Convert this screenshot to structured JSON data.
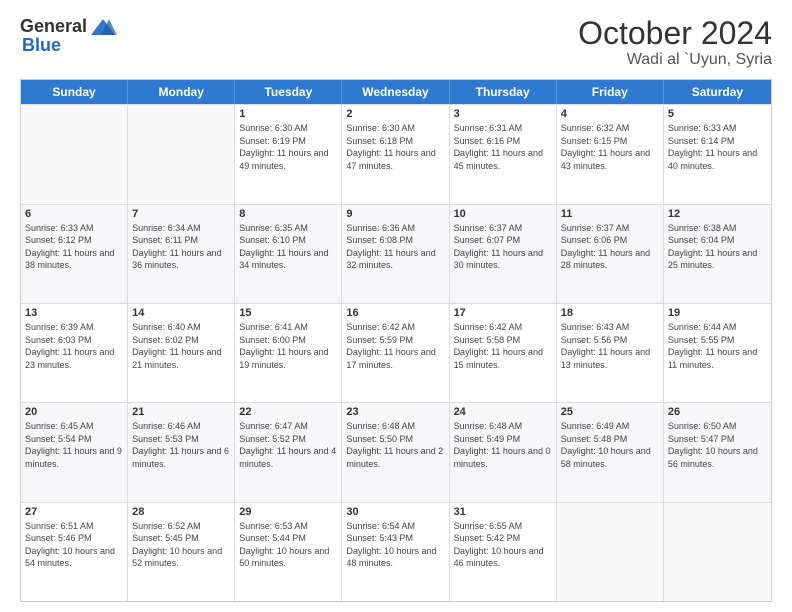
{
  "logo": {
    "general": "General",
    "blue": "Blue"
  },
  "title": "October 2024",
  "location": "Wadi al `Uyun, Syria",
  "days_of_week": [
    "Sunday",
    "Monday",
    "Tuesday",
    "Wednesday",
    "Thursday",
    "Friday",
    "Saturday"
  ],
  "rows": [
    [
      {
        "date": "",
        "sunrise": "",
        "sunset": "",
        "daylight": "",
        "empty": true
      },
      {
        "date": "",
        "sunrise": "",
        "sunset": "",
        "daylight": "",
        "empty": true
      },
      {
        "date": "1",
        "sunrise": "Sunrise: 6:30 AM",
        "sunset": "Sunset: 6:19 PM",
        "daylight": "Daylight: 11 hours and 49 minutes.",
        "empty": false
      },
      {
        "date": "2",
        "sunrise": "Sunrise: 6:30 AM",
        "sunset": "Sunset: 6:18 PM",
        "daylight": "Daylight: 11 hours and 47 minutes.",
        "empty": false
      },
      {
        "date": "3",
        "sunrise": "Sunrise: 6:31 AM",
        "sunset": "Sunset: 6:16 PM",
        "daylight": "Daylight: 11 hours and 45 minutes.",
        "empty": false
      },
      {
        "date": "4",
        "sunrise": "Sunrise: 6:32 AM",
        "sunset": "Sunset: 6:15 PM",
        "daylight": "Daylight: 11 hours and 43 minutes.",
        "empty": false
      },
      {
        "date": "5",
        "sunrise": "Sunrise: 6:33 AM",
        "sunset": "Sunset: 6:14 PM",
        "daylight": "Daylight: 11 hours and 40 minutes.",
        "empty": false
      }
    ],
    [
      {
        "date": "6",
        "sunrise": "Sunrise: 6:33 AM",
        "sunset": "Sunset: 6:12 PM",
        "daylight": "Daylight: 11 hours and 38 minutes.",
        "empty": false
      },
      {
        "date": "7",
        "sunrise": "Sunrise: 6:34 AM",
        "sunset": "Sunset: 6:11 PM",
        "daylight": "Daylight: 11 hours and 36 minutes.",
        "empty": false
      },
      {
        "date": "8",
        "sunrise": "Sunrise: 6:35 AM",
        "sunset": "Sunset: 6:10 PM",
        "daylight": "Daylight: 11 hours and 34 minutes.",
        "empty": false
      },
      {
        "date": "9",
        "sunrise": "Sunrise: 6:36 AM",
        "sunset": "Sunset: 6:08 PM",
        "daylight": "Daylight: 11 hours and 32 minutes.",
        "empty": false
      },
      {
        "date": "10",
        "sunrise": "Sunrise: 6:37 AM",
        "sunset": "Sunset: 6:07 PM",
        "daylight": "Daylight: 11 hours and 30 minutes.",
        "empty": false
      },
      {
        "date": "11",
        "sunrise": "Sunrise: 6:37 AM",
        "sunset": "Sunset: 6:06 PM",
        "daylight": "Daylight: 11 hours and 28 minutes.",
        "empty": false
      },
      {
        "date": "12",
        "sunrise": "Sunrise: 6:38 AM",
        "sunset": "Sunset: 6:04 PM",
        "daylight": "Daylight: 11 hours and 25 minutes.",
        "empty": false
      }
    ],
    [
      {
        "date": "13",
        "sunrise": "Sunrise: 6:39 AM",
        "sunset": "Sunset: 6:03 PM",
        "daylight": "Daylight: 11 hours and 23 minutes.",
        "empty": false
      },
      {
        "date": "14",
        "sunrise": "Sunrise: 6:40 AM",
        "sunset": "Sunset: 6:02 PM",
        "daylight": "Daylight: 11 hours and 21 minutes.",
        "empty": false
      },
      {
        "date": "15",
        "sunrise": "Sunrise: 6:41 AM",
        "sunset": "Sunset: 6:00 PM",
        "daylight": "Daylight: 11 hours and 19 minutes.",
        "empty": false
      },
      {
        "date": "16",
        "sunrise": "Sunrise: 6:42 AM",
        "sunset": "Sunset: 5:59 PM",
        "daylight": "Daylight: 11 hours and 17 minutes.",
        "empty": false
      },
      {
        "date": "17",
        "sunrise": "Sunrise: 6:42 AM",
        "sunset": "Sunset: 5:58 PM",
        "daylight": "Daylight: 11 hours and 15 minutes.",
        "empty": false
      },
      {
        "date": "18",
        "sunrise": "Sunrise: 6:43 AM",
        "sunset": "Sunset: 5:56 PM",
        "daylight": "Daylight: 11 hours and 13 minutes.",
        "empty": false
      },
      {
        "date": "19",
        "sunrise": "Sunrise: 6:44 AM",
        "sunset": "Sunset: 5:55 PM",
        "daylight": "Daylight: 11 hours and 11 minutes.",
        "empty": false
      }
    ],
    [
      {
        "date": "20",
        "sunrise": "Sunrise: 6:45 AM",
        "sunset": "Sunset: 5:54 PM",
        "daylight": "Daylight: 11 hours and 9 minutes.",
        "empty": false
      },
      {
        "date": "21",
        "sunrise": "Sunrise: 6:46 AM",
        "sunset": "Sunset: 5:53 PM",
        "daylight": "Daylight: 11 hours and 6 minutes.",
        "empty": false
      },
      {
        "date": "22",
        "sunrise": "Sunrise: 6:47 AM",
        "sunset": "Sunset: 5:52 PM",
        "daylight": "Daylight: 11 hours and 4 minutes.",
        "empty": false
      },
      {
        "date": "23",
        "sunrise": "Sunrise: 6:48 AM",
        "sunset": "Sunset: 5:50 PM",
        "daylight": "Daylight: 11 hours and 2 minutes.",
        "empty": false
      },
      {
        "date": "24",
        "sunrise": "Sunrise: 6:48 AM",
        "sunset": "Sunset: 5:49 PM",
        "daylight": "Daylight: 11 hours and 0 minutes.",
        "empty": false
      },
      {
        "date": "25",
        "sunrise": "Sunrise: 6:49 AM",
        "sunset": "Sunset: 5:48 PM",
        "daylight": "Daylight: 10 hours and 58 minutes.",
        "empty": false
      },
      {
        "date": "26",
        "sunrise": "Sunrise: 6:50 AM",
        "sunset": "Sunset: 5:47 PM",
        "daylight": "Daylight: 10 hours and 56 minutes.",
        "empty": false
      }
    ],
    [
      {
        "date": "27",
        "sunrise": "Sunrise: 6:51 AM",
        "sunset": "Sunset: 5:46 PM",
        "daylight": "Daylight: 10 hours and 54 minutes.",
        "empty": false
      },
      {
        "date": "28",
        "sunrise": "Sunrise: 6:52 AM",
        "sunset": "Sunset: 5:45 PM",
        "daylight": "Daylight: 10 hours and 52 minutes.",
        "empty": false
      },
      {
        "date": "29",
        "sunrise": "Sunrise: 6:53 AM",
        "sunset": "Sunset: 5:44 PM",
        "daylight": "Daylight: 10 hours and 50 minutes.",
        "empty": false
      },
      {
        "date": "30",
        "sunrise": "Sunrise: 6:54 AM",
        "sunset": "Sunset: 5:43 PM",
        "daylight": "Daylight: 10 hours and 48 minutes.",
        "empty": false
      },
      {
        "date": "31",
        "sunrise": "Sunrise: 6:55 AM",
        "sunset": "Sunset: 5:42 PM",
        "daylight": "Daylight: 10 hours and 46 minutes.",
        "empty": false
      },
      {
        "date": "",
        "sunrise": "",
        "sunset": "",
        "daylight": "",
        "empty": true
      },
      {
        "date": "",
        "sunrise": "",
        "sunset": "",
        "daylight": "",
        "empty": true
      }
    ]
  ]
}
